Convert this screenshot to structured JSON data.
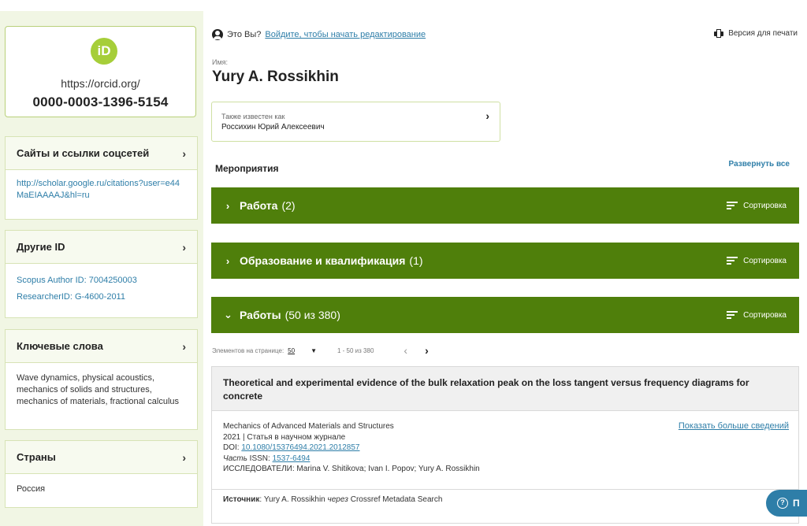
{
  "sidebar": {
    "orcid_logo": "iD",
    "orcid_url": "https://orcid.org/",
    "orcid_id": "0000-0003-1396-5154",
    "websites": {
      "title": "Сайты и ссылки соцсетей",
      "link": "http://scholar.google.ru/citations?user=e44MaEIAAAAJ&hl=ru"
    },
    "other_ids": {
      "title": "Другие ID",
      "items": [
        "Scopus Author ID: 7004250003",
        "ResearcherID: G-4600-2011"
      ]
    },
    "keywords": {
      "title": "Ключевые слова",
      "text": "Wave dynamics, physical acoustics, mechanics of solids and structures, mechanics of materials, fractional calculus"
    },
    "countries": {
      "title": "Страны",
      "value": "Россия"
    }
  },
  "header": {
    "is_you": "Это Вы?",
    "signin_link": "Войдите, чтобы начать редактирование",
    "print_label": "Версия для печати"
  },
  "profile": {
    "name_label": "Имя:",
    "name": "Yury A. Rossikhin",
    "aka_label": "Также известен как",
    "aka_value": "Россихин Юрий Алексеевич"
  },
  "activities": {
    "title": "Мероприятия",
    "expand_all": "Развернуть все",
    "sort_label": "Сортировка",
    "sections": [
      {
        "arrow": "›",
        "title": "Работа",
        "count": "(2)"
      },
      {
        "arrow": "›",
        "title": "Образование и квалификация",
        "count": "(1)"
      },
      {
        "arrow": "⌄",
        "title": "Работы",
        "count": "(50 из 380)"
      }
    ]
  },
  "pager": {
    "per_page_label": "Элементов на странице:",
    "per_page": "50",
    "range": "1 - 50 из 380"
  },
  "work": {
    "title": "Theoretical and experimental evidence of the bulk relaxation peak on the loss tangent versus frequency diagrams for concrete",
    "journal": "Mechanics of Advanced Materials and Structures",
    "year_type": "2021 | Статья в научном журнале",
    "doi_label": "DOI:",
    "doi": "10.1080/15376494.2021.2012857",
    "part_label": "Часть",
    "issn_label": "ISSN:",
    "issn": "1537-6494",
    "researchers": "ИССЛЕДОВАТЕЛИ: Marina V. Shitikova; Ivan I. Popov; Yury A. Rossikhin",
    "more": "Показать больше сведений",
    "source_label": "Источник",
    "source_text": ": Yury A. Rossikhin",
    "via": "через",
    "source_db": "Crossref Metadata Search"
  },
  "help": {
    "label": "П"
  }
}
